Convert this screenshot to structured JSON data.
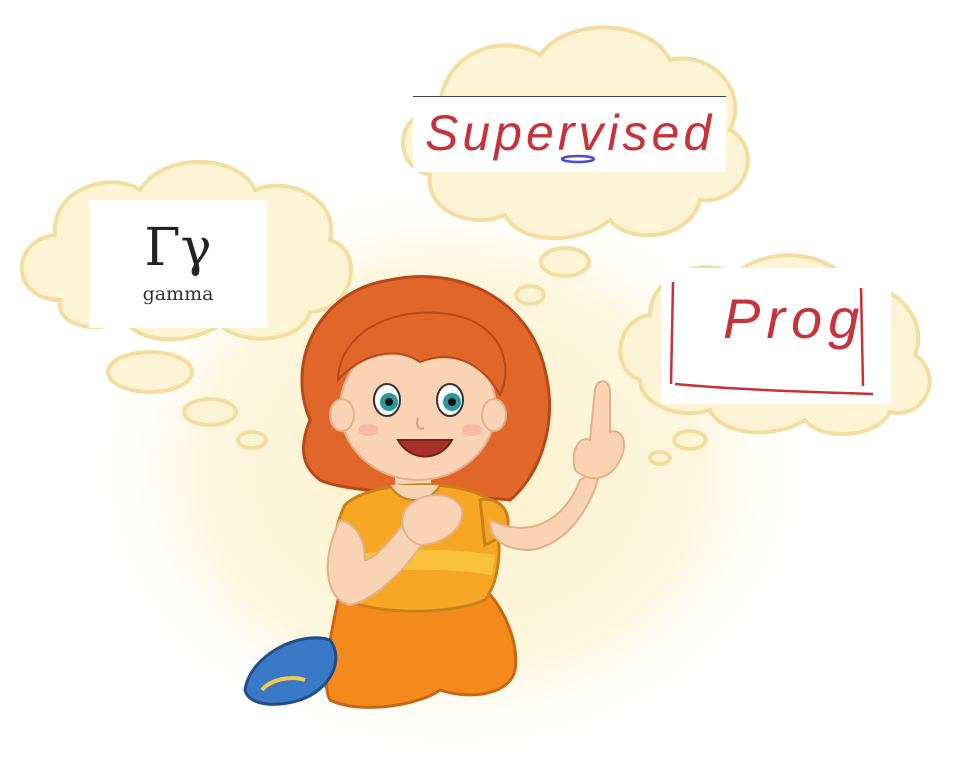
{
  "colors": {
    "cloud_fill": "#fdf4d6",
    "cloud_stroke": "#f3dea0",
    "glow": "#fbf0c8",
    "hair": "#e0662a",
    "shirt": "#f6a623",
    "pants": "#f58a1c",
    "skin": "#f9d3b4",
    "shoe": "#3a78c8",
    "ink_red": "#c8323a",
    "ink_blue": "#4a4ad6"
  },
  "cards": {
    "gamma": {
      "symbol": "Γγ",
      "word": "gamma"
    },
    "supervised": {
      "text": "Supervised"
    },
    "prog": {
      "text": "Prog"
    }
  }
}
